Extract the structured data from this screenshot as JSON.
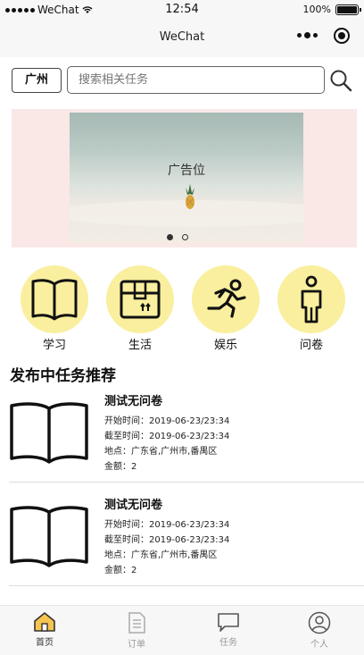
{
  "status_bar": {
    "carrier": "WeChat",
    "time": "12:54",
    "battery": "100%"
  },
  "navbar": {
    "title": "WeChat"
  },
  "search": {
    "city": "广州",
    "placeholder": "搜索相关任务"
  },
  "banner": {
    "label": "广告位",
    "slide_count": 2,
    "active_slide": 1
  },
  "categories": [
    {
      "label": "学习",
      "icon": "book-icon"
    },
    {
      "label": "生活",
      "icon": "box-icon"
    },
    {
      "label": "娱乐",
      "icon": "runner-icon"
    },
    {
      "label": "问卷",
      "icon": "person-icon"
    }
  ],
  "section_title": "发布中任务推荐",
  "tasks": [
    {
      "name": "测试无问卷",
      "start": "开始时间：2019-06-23/23:34",
      "end": "截至时间：2019-06-23/23:34",
      "location": "地点：广东省,广州市,番禺区",
      "amount": "金额：2"
    },
    {
      "name": "测试无问卷",
      "start": "开始时间：2019-06-23/23:34",
      "end": "截至时间：2019-06-23/23:34",
      "location": "地点：广东省,广州市,番禺区",
      "amount": "金额：2"
    }
  ],
  "tabbar": [
    {
      "label": "首页",
      "icon": "home-icon",
      "active": true
    },
    {
      "label": "订单",
      "icon": "order-icon",
      "active": false
    },
    {
      "label": "任务",
      "icon": "chat-icon",
      "active": false
    },
    {
      "label": "个人",
      "icon": "user-icon",
      "active": false
    }
  ],
  "colors": {
    "accent_yellow": "#f9ef9e",
    "banner_bg": "#f9e8e6",
    "active_tab_icon": "#f5c451"
  }
}
